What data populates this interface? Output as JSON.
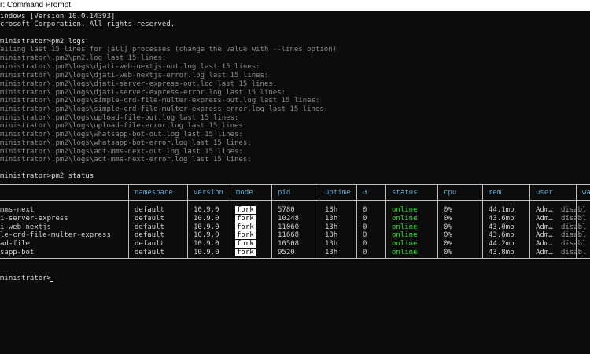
{
  "window": {
    "title": "r: Command Prompt"
  },
  "console": {
    "header_lines": [
      "indows [Version 10.0.14393]",
      "crosoft Corporation. All rights reserved."
    ],
    "command1": "ministrator>pm2 logs",
    "log_lines": [
      "ailing last 15 lines for [all] processes (change the value with --lines option)",
      "ministrator\\.pm2\\pm2.log last 15 lines:",
      "ministrator\\.pm2\\logs\\djati-web-nextjs-out.log last 15 lines:",
      "ministrator\\.pm2\\logs\\djati-web-nextjs-error.log last 15 lines:",
      "ministrator\\.pm2\\logs\\djati-server-express-out.log last 15 lines:",
      "ministrator\\.pm2\\logs\\djati-server-express-error.log last 15 lines:",
      "ministrator\\.pm2\\logs\\simple-crd-file-multer-express-out.log last 15 lines:",
      "ministrator\\.pm2\\logs\\simple-crd-file-multer-express-error.log last 15 lines:",
      "ministrator\\.pm2\\logs\\upload-file-out.log last 15 lines:",
      "ministrator\\.pm2\\logs\\upload-file-error.log last 15 lines:",
      "ministrator\\.pm2\\logs\\whatsapp-bot-out.log last 15 lines:",
      "ministrator\\.pm2\\logs\\whatsapp-bot-error.log last 15 lines:",
      "ministrator\\.pm2\\logs\\adt-mms-next-out.log last 15 lines:",
      "ministrator\\.pm2\\logs\\adt-mms-next-error.log last 15 lines:"
    ],
    "command2": "ministrator>pm2 status",
    "prompt": "ministrator>"
  },
  "table": {
    "headers": {
      "namespace": "namespace",
      "version": "version",
      "mode": "mode",
      "pid": "pid",
      "uptime": "uptime",
      "restarts": "↺",
      "status": "status",
      "cpu": "cpu",
      "mem": "mem",
      "user": "user",
      "watching": "wa"
    },
    "rows": [
      {
        "name": "mms-next",
        "namespace": "default",
        "version": "10.9.0",
        "mode": "fork",
        "pid": "5780",
        "uptime": "13h",
        "restarts": "0",
        "status": "online",
        "cpu": "0%",
        "mem": "44.1mb",
        "user": "Adm…",
        "watching": "disabl"
      },
      {
        "name": "i-server-express",
        "namespace": "default",
        "version": "10.9.0",
        "mode": "fork",
        "pid": "10248",
        "uptime": "13h",
        "restarts": "0",
        "status": "online",
        "cpu": "0%",
        "mem": "43.6mb",
        "user": "Adm…",
        "watching": "disabl"
      },
      {
        "name": "i-web-nextjs",
        "namespace": "default",
        "version": "10.9.0",
        "mode": "fork",
        "pid": "11060",
        "uptime": "13h",
        "restarts": "0",
        "status": "online",
        "cpu": "0%",
        "mem": "43.0mb",
        "user": "Adm…",
        "watching": "disabl"
      },
      {
        "name": "le-crd-file-multer-express",
        "namespace": "default",
        "version": "10.9.0",
        "mode": "fork",
        "pid": "11668",
        "uptime": "13h",
        "restarts": "0",
        "status": "online",
        "cpu": "0%",
        "mem": "43.6mb",
        "user": "Adm…",
        "watching": "disabl"
      },
      {
        "name": "ad-file",
        "namespace": "default",
        "version": "10.9.0",
        "mode": "fork",
        "pid": "10508",
        "uptime": "13h",
        "restarts": "0",
        "status": "online",
        "cpu": "0%",
        "mem": "44.2mb",
        "user": "Adm…",
        "watching": "disabl"
      },
      {
        "name": "sapp-bot",
        "namespace": "default",
        "version": "10.9.0",
        "mode": "fork",
        "pid": "9520",
        "uptime": "13h",
        "restarts": "0",
        "status": "online",
        "cpu": "0%",
        "mem": "43.8mb",
        "user": "Adm…",
        "watching": "disabl"
      }
    ]
  },
  "colors": {
    "background": "#0c0c0c",
    "text": "#cccccc",
    "header": "#5fa8d3",
    "online": "#2ee32e",
    "title_bar": "#ffffff"
  }
}
